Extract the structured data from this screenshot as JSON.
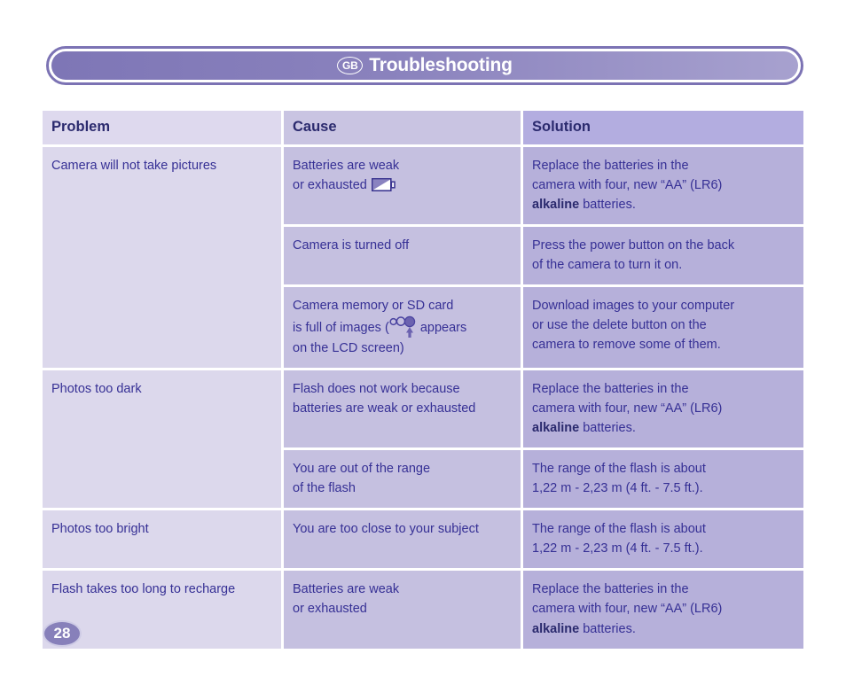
{
  "header": {
    "region_badge": "GB",
    "title": "Troubleshooting"
  },
  "table": {
    "columns": [
      "Problem",
      "Cause",
      "Solution"
    ],
    "rows": [
      {
        "problem": "Camera will not take pictures",
        "problem_rowspan": 3,
        "cause_line1": "Batteries are weak",
        "cause_line2": "or exhausted",
        "cause_icon": "low-battery-icon",
        "solution_line1": "Replace the batteries in the",
        "solution_line2": "camera with four, new “AA” (LR6)",
        "solution_bold": "alkaline",
        "solution_line3_rest": " batteries."
      },
      {
        "cause_line1": "Camera is turned off",
        "solution_line1": "Press the power button on the back",
        "solution_line2": "of the camera to turn it on."
      },
      {
        "cause_line1": "Camera memory or SD card",
        "cause_line2_before": "is full of images (",
        "cause_icon": "memory-full-icon",
        "cause_line2_after": " appears",
        "cause_line3": "on the LCD screen)",
        "solution_line1": "Download images to your computer",
        "solution_line2": "or use the delete button on the",
        "solution_line3": "camera to remove some of them."
      },
      {
        "problem": "Photos too dark",
        "problem_rowspan": 2,
        "cause_line1": "Flash does not work because",
        "cause_line2": "batteries are weak or exhausted",
        "solution_line1": "Replace the batteries in the",
        "solution_line2": "camera with four, new “AA” (LR6)",
        "solution_bold": "alkaline",
        "solution_line3_rest": " batteries."
      },
      {
        "cause_line1": "You are out of the range",
        "cause_line2": "of the flash",
        "solution_line1": "The range of the flash is about",
        "solution_line2": "1,22 m - 2,23 m (4 ft. - 7.5 ft.)."
      },
      {
        "problem": "Photos too bright",
        "problem_rowspan": 1,
        "cause_line1": "You are too close to your subject",
        "solution_line1": "The range of the flash is about",
        "solution_line2": "1,22 m - 2,23 m (4 ft. - 7.5 ft.)."
      },
      {
        "problem": "Flash takes too long to recharge",
        "problem_rowspan": 1,
        "cause_line1": "Batteries are weak",
        "cause_line2": "or exhausted",
        "solution_line1": "Replace the batteries in the",
        "solution_line2": "camera with four, new “AA” (LR6)",
        "solution_bold": "alkaline",
        "solution_line3_rest": " batteries."
      }
    ]
  },
  "footer": {
    "page_number": "28"
  },
  "colors": {
    "accent": "#7c73b4",
    "header_gradient_start": "#7e76b6",
    "header_gradient_end": "#a7a1cf",
    "col1_bg": "#dcd8ec",
    "col2_bg": "#c5c0e0",
    "col3_bg": "#b6b0da",
    "text": "#363095",
    "heading_text": "#2b2a6e"
  }
}
